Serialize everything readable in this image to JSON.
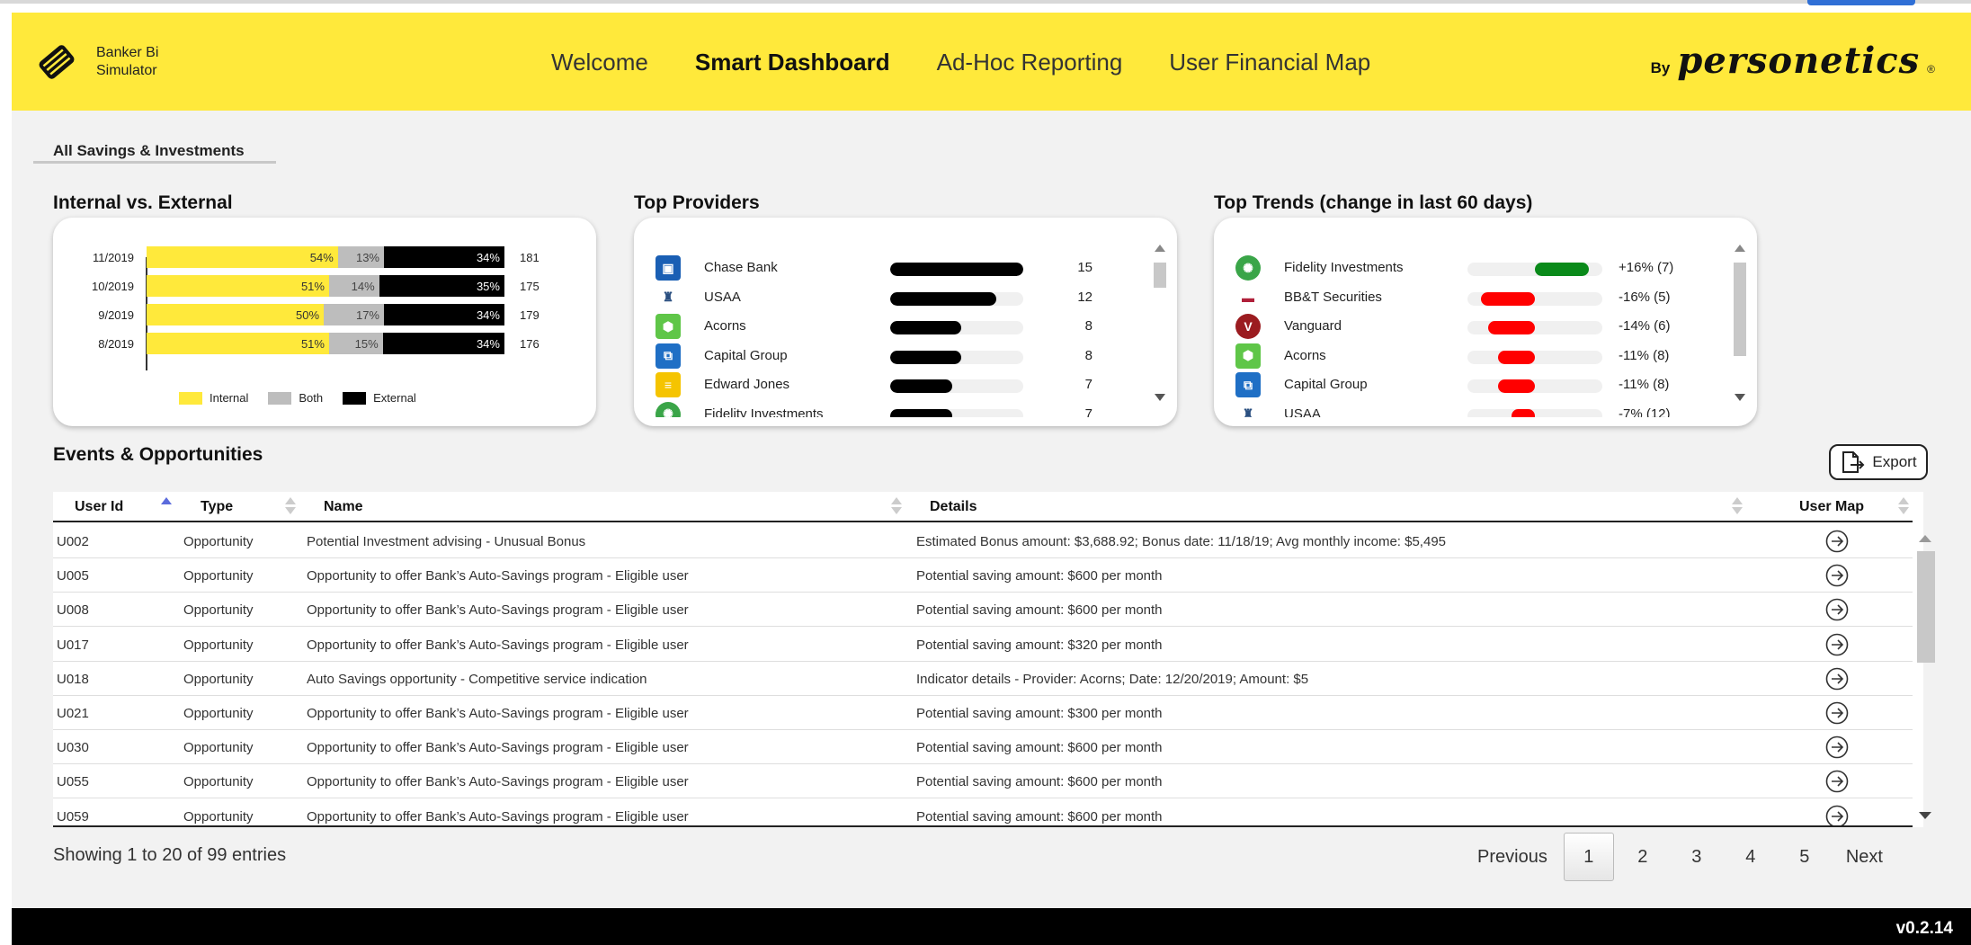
{
  "header": {
    "brand_line1": "Banker Bi",
    "brand_line2": "Simulator",
    "nav": [
      {
        "label": "Welcome",
        "active": false
      },
      {
        "label": "Smart Dashboard",
        "active": true
      },
      {
        "label": "Ad-Hoc Reporting",
        "active": false
      },
      {
        "label": "User Financial Map",
        "active": false
      }
    ],
    "vendor_by": "By",
    "vendor_name": "personetics",
    "vendor_reg": "®"
  },
  "page_tab": "All Savings & Investments",
  "internal_external": {
    "title": "Internal vs. External",
    "legend": [
      "Internal",
      "Both",
      "External"
    ],
    "colors": {
      "internal": "#ffe93b",
      "both": "#bdbdbd",
      "external": "#000000"
    }
  },
  "chart_data": {
    "type": "bar",
    "orientation": "horizontal",
    "stacked": true,
    "title": "Internal vs. External",
    "categories": [
      "11/2019",
      "10/2019",
      "9/2019",
      "8/2019"
    ],
    "series": [
      {
        "name": "Internal",
        "values": [
          54,
          51,
          50,
          51
        ],
        "labels": [
          "54%",
          "51%",
          "50%",
          "51%"
        ]
      },
      {
        "name": "Both",
        "values": [
          13,
          14,
          17,
          15
        ],
        "labels": [
          "13%",
          "14%",
          "17%",
          "15%"
        ]
      },
      {
        "name": "External",
        "values": [
          34,
          35,
          34,
          34
        ],
        "labels": [
          "34%",
          "35%",
          "34%",
          "34%"
        ]
      }
    ],
    "totals": [
      "181",
      "175",
      "179",
      "176"
    ],
    "legend_position": "bottom"
  },
  "top_providers": {
    "title": "Top Providers",
    "max": 15,
    "items": [
      {
        "name": "Chase Bank",
        "count": 15,
        "count_label": "15",
        "icon": "chase-icon",
        "color": "#1a5fb4",
        "glyph": "▣"
      },
      {
        "name": "USAA",
        "count": 12,
        "count_label": "12",
        "icon": "usaa-icon",
        "color": "#ffffff",
        "glyph": "♜"
      },
      {
        "name": "Acorns",
        "count": 8,
        "count_label": "8",
        "icon": "acorns-icon",
        "color": "#5fc648",
        "glyph": "⬢"
      },
      {
        "name": "Capital Group",
        "count": 8,
        "count_label": "8",
        "icon": "capital-group-icon",
        "color": "#1f6fc5",
        "glyph": "⧉"
      },
      {
        "name": "Edward Jones",
        "count": 7,
        "count_label": "7",
        "icon": "edward-jones-icon",
        "color": "#f5c400",
        "glyph": "≡"
      },
      {
        "name": "Fidelity Investments",
        "count": 7,
        "count_label": "7",
        "icon": "fidelity-icon",
        "color": "#3aa548",
        "glyph": "✺"
      }
    ]
  },
  "top_trends": {
    "title": "Top Trends (change in last 60 days)",
    "items": [
      {
        "name": "Fidelity Investments",
        "change": 16,
        "value": "+16% (7)",
        "icon": "fidelity-icon",
        "color": "#3aa548",
        "glyph": "✺"
      },
      {
        "name": "BB&T Securities",
        "change": -16,
        "value": "-16% (5)",
        "icon": "bbt-icon",
        "color": "#ffffff",
        "glyph": "▬"
      },
      {
        "name": "Vanguard",
        "change": -14,
        "value": "-14% (6)",
        "icon": "vanguard-icon",
        "color": "#9b1c20",
        "glyph": "V"
      },
      {
        "name": "Acorns",
        "change": -11,
        "value": "-11% (8)",
        "icon": "acorns-icon",
        "color": "#5fc648",
        "glyph": "⬢"
      },
      {
        "name": "Capital Group",
        "change": -11,
        "value": "-11% (8)",
        "icon": "capital-group-icon",
        "color": "#1f6fc5",
        "glyph": "⧉"
      },
      {
        "name": "USAA",
        "change": -7,
        "value": "-7% (12)",
        "icon": "usaa-icon",
        "color": "#ffffff",
        "glyph": "♜"
      }
    ],
    "positive_color": "#0a8a1a",
    "negative_color": "#ff0000"
  },
  "events": {
    "title": "Events & Opportunities",
    "export_label": "Export",
    "columns": [
      "User Id",
      "Type",
      "Name",
      "Details",
      "User Map"
    ],
    "rows": [
      [
        "U002",
        "Opportunity",
        "Potential Investment advising - Unusual Bonus",
        "Estimated Bonus amount: $3,688.92; Bonus date: 11/18/19; Avg monthly income: $5,495"
      ],
      [
        "U005",
        "Opportunity",
        "Opportunity to offer Bank’s Auto-Savings program - Eligible user",
        "Potential saving amount: $600 per month"
      ],
      [
        "U008",
        "Opportunity",
        "Opportunity to offer Bank’s Auto-Savings program - Eligible user",
        "Potential saving amount: $600 per month"
      ],
      [
        "U017",
        "Opportunity",
        "Opportunity to offer Bank’s Auto-Savings program - Eligible user",
        "Potential saving amount: $320 per month"
      ],
      [
        "U018",
        "Opportunity",
        "Auto Savings opportunity - Competitive service indication",
        "Indicator details - Provider: Acorns; Date: 12/20/2019; Amount: $5"
      ],
      [
        "U021",
        "Opportunity",
        "Opportunity to offer Bank’s Auto-Savings program - Eligible user",
        "Potential saving amount: $300 per month"
      ],
      [
        "U030",
        "Opportunity",
        "Opportunity to offer Bank’s Auto-Savings program - Eligible user",
        "Potential saving amount: $600 per month"
      ],
      [
        "U055",
        "Opportunity",
        "Opportunity to offer Bank’s Auto-Savings program - Eligible user",
        "Potential saving amount: $600 per month"
      ],
      [
        "U059",
        "Opportunity",
        "Opportunity to offer Bank’s Auto-Savings program - Eligible user",
        "Potential saving amount: $600 per month"
      ]
    ],
    "showing": "Showing 1 to 20 of 99 entries",
    "pagination": {
      "previous": "Previous",
      "pages": [
        "1",
        "2",
        "3",
        "4",
        "5"
      ],
      "current": "1",
      "next": "Next"
    }
  },
  "footer": {
    "version": "v0.2.14"
  }
}
